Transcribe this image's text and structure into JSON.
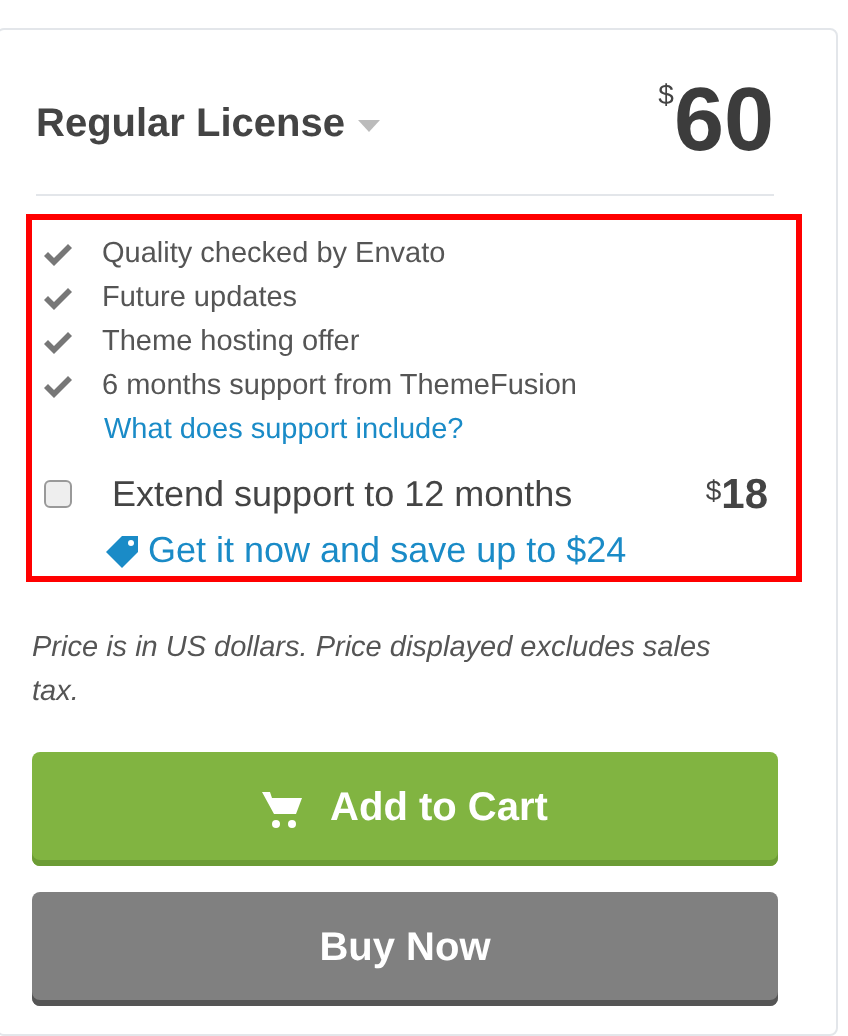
{
  "license": {
    "name": "Regular License",
    "currency": "$",
    "price": "60"
  },
  "features": [
    "Quality checked by Envato",
    "Future updates",
    "Theme hosting offer",
    "6 months support from ThemeFusion"
  ],
  "support_link": "What does support include?",
  "extend": {
    "label": "Extend support to 12 months",
    "checked": false,
    "currency": "$",
    "price": "18",
    "offer": "Get it now and save up to $24"
  },
  "note": "Price is in US dollars. Price displayed excludes sales tax.",
  "buttons": [
    {
      "kind": "cart",
      "label": "Add to Cart"
    },
    {
      "kind": "buy",
      "label": "Buy Now"
    }
  ]
}
